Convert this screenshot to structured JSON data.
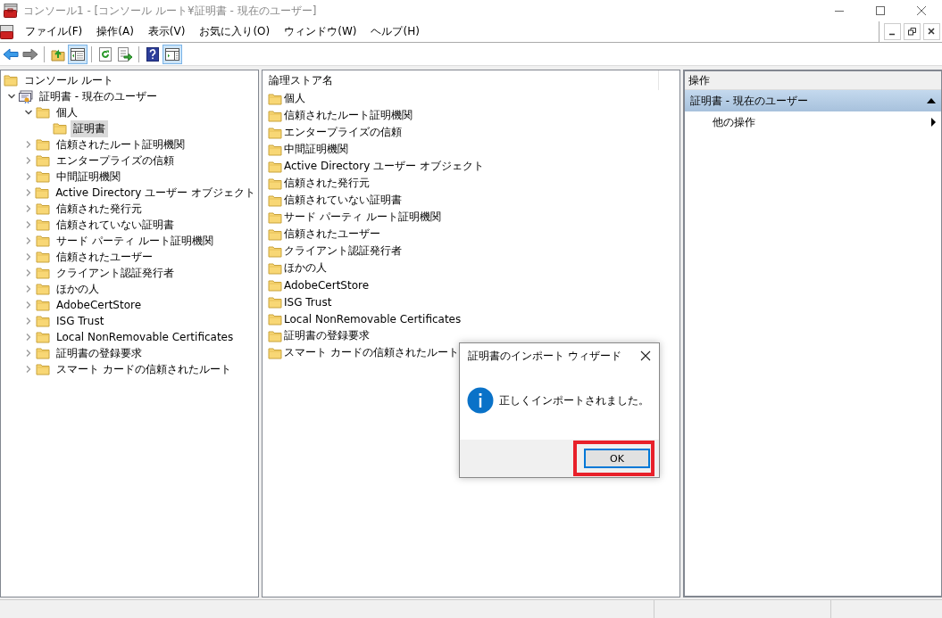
{
  "window": {
    "title": "コンソール1 - [コンソール ルート¥証明書 - 現在のユーザー]"
  },
  "menu": [
    "ファイル(F)",
    "操作(A)",
    "表示(V)",
    "お気に入り(O)",
    "ウィンドウ(W)",
    "ヘルプ(H)"
  ],
  "toolbar": [
    {
      "kind": "back",
      "pressed": false
    },
    {
      "kind": "forward",
      "pressed": false
    },
    {
      "kind": "sep"
    },
    {
      "kind": "up",
      "pressed": false
    },
    {
      "kind": "tree",
      "pressed": true
    },
    {
      "kind": "sep"
    },
    {
      "kind": "refresh",
      "pressed": false
    },
    {
      "kind": "export",
      "pressed": false
    },
    {
      "kind": "sep"
    },
    {
      "kind": "help",
      "pressed": false
    },
    {
      "kind": "actions",
      "pressed": true
    }
  ],
  "tree": [
    {
      "label": "コンソール ルート",
      "selected": false,
      "children": [
        {
          "label": "証明書 - 現在のユーザー",
          "selected": false,
          "expanded": true,
          "children": [
            {
              "label": "個人",
              "selected": false,
              "expanded": true,
              "children": [
                {
                  "label": "証明書",
                  "selected": true
                }
              ]
            },
            {
              "label": "信頼されたルート証明機関",
              "selected": false,
              "expanded": false
            },
            {
              "label": "エンタープライズの信頼",
              "selected": false,
              "expanded": false
            },
            {
              "label": "中間証明機関",
              "selected": false,
              "expanded": false
            },
            {
              "label": "Active Directory ユーザー オブジェクト",
              "selected": false,
              "expanded": false
            },
            {
              "label": "信頼された発行元",
              "selected": false,
              "expanded": false
            },
            {
              "label": "信頼されていない証明書",
              "selected": false,
              "expanded": false
            },
            {
              "label": "サード パーティ ルート証明機関",
              "selected": false,
              "expanded": false
            },
            {
              "label": "信頼されたユーザー",
              "selected": false,
              "expanded": false
            },
            {
              "label": "クライアント認証発行者",
              "selected": false,
              "expanded": false
            },
            {
              "label": "ほかの人",
              "selected": false,
              "expanded": false
            },
            {
              "label": "AdobeCertStore",
              "selected": false,
              "expanded": false
            },
            {
              "label": "ISG Trust",
              "selected": false,
              "expanded": false
            },
            {
              "label": "Local NonRemovable Certificates",
              "selected": false,
              "expanded": false
            },
            {
              "label": "証明書の登録要求",
              "selected": false,
              "expanded": false
            },
            {
              "label": "スマート カードの信頼されたルート",
              "selected": false,
              "expanded": false
            }
          ]
        }
      ]
    }
  ],
  "list": {
    "columns": [
      "論理ストア名"
    ],
    "rows": [
      "個人",
      "信頼されたルート証明機関",
      "エンタープライズの信頼",
      "中間証明機関",
      "Active Directory ユーザー オブジェクト",
      "信頼された発行元",
      "信頼されていない証明書",
      "サード パーティ ルート証明機関",
      "信頼されたユーザー",
      "クライアント認証発行者",
      "ほかの人",
      "AdobeCertStore",
      "ISG Trust",
      "Local NonRemovable Certificates",
      "証明書の登録要求",
      "スマート カードの信頼されたルート"
    ]
  },
  "actions": {
    "title": "操作",
    "sections": [
      {
        "title": "証明書 - 現在のユーザー",
        "expanded": true,
        "items": [
          "他の操作"
        ]
      }
    ]
  },
  "dialog": {
    "title": "証明書のインポート ウィザード",
    "message": "正しくインポートされました。",
    "button": "OK",
    "button_highlighted": true
  }
}
